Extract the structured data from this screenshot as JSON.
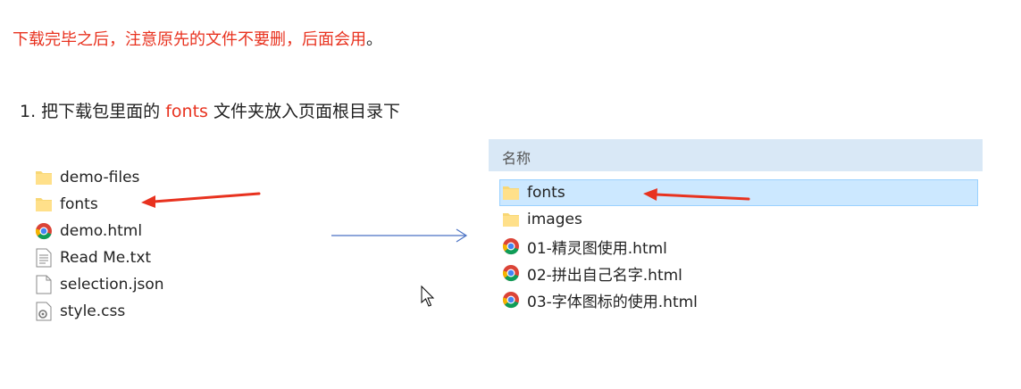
{
  "warning": {
    "text": "下载完毕之后，注意原先的文件不要删，后面会用",
    "tail": "。"
  },
  "step": {
    "prefix": "1. 把下载包里面的 ",
    "highlight": "fonts",
    "suffix": " 文件夹放入页面根目录下"
  },
  "left_files": [
    {
      "label": "demo-files",
      "icon": "folder-icon"
    },
    {
      "label": "fonts",
      "icon": "folder-icon"
    },
    {
      "label": "demo.html",
      "icon": "chrome-icon"
    },
    {
      "label": "Read Me.txt",
      "icon": "text-file-icon"
    },
    {
      "label": "selection.json",
      "icon": "blank-file-icon"
    },
    {
      "label": "style.css",
      "icon": "css-file-icon"
    }
  ],
  "right_panel": {
    "column_header": "名称",
    "files": [
      {
        "label": "fonts",
        "icon": "folder-icon",
        "selected": true
      },
      {
        "label": "images",
        "icon": "folder-icon",
        "selected": false
      },
      {
        "label": "01-精灵图使用.html",
        "icon": "chrome-icon",
        "selected": false
      },
      {
        "label": "02-拼出自己名字.html",
        "icon": "chrome-icon",
        "selected": false
      },
      {
        "label": "03-字体图标的使用.html",
        "icon": "chrome-icon",
        "selected": false
      }
    ]
  },
  "colors": {
    "accent_red": "#e8321f",
    "arrow_blue": "#4a72c4",
    "header_bg": "#d9e8f6",
    "selection_bg": "#cce8ff"
  }
}
